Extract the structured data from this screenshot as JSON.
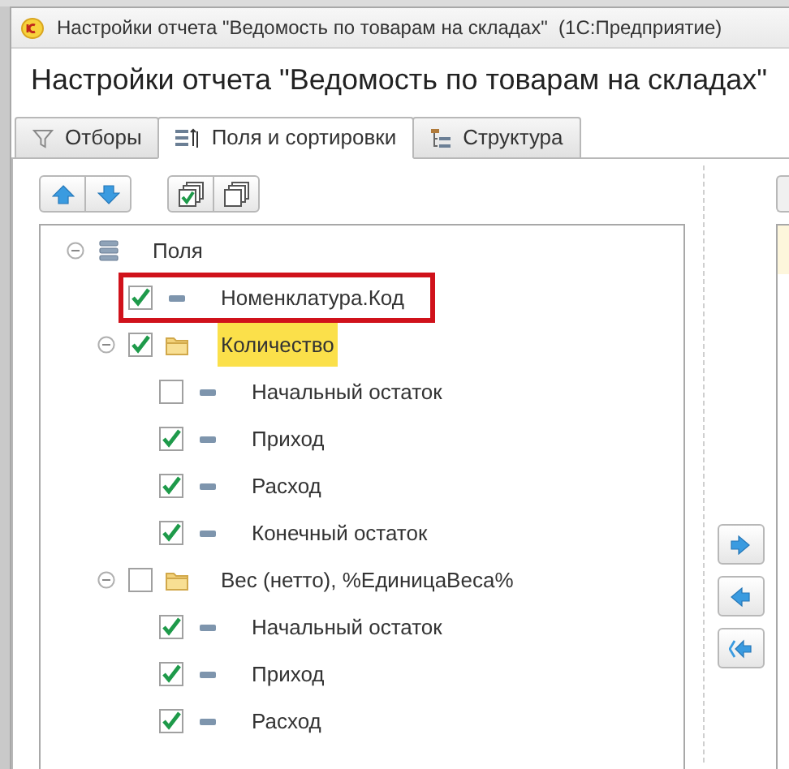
{
  "window": {
    "title": "Настройки отчета \"Ведомость по товарам на складах\"  (1С:Предприятие)"
  },
  "heading": "Настройки отчета \"Ведомость по товарам на складах\"",
  "tabs": [
    {
      "label": "Отборы",
      "kind": "filter",
      "selected": false
    },
    {
      "label": "Поля и сортировки",
      "kind": "fields",
      "selected": true
    },
    {
      "label": "Структура",
      "kind": "structure",
      "selected": false
    }
  ],
  "toolbar": [
    {
      "kind": "up"
    },
    {
      "kind": "down"
    },
    {
      "kind": "check-all"
    },
    {
      "kind": "uncheck-all"
    }
  ],
  "tree": [
    {
      "label": "Поля",
      "kind": "root",
      "expanded": true,
      "outlined": false,
      "selected": false,
      "children": [
        {
          "label": "Номенклатура.Код",
          "kind": "field",
          "checked": true,
          "outlined": true,
          "selected": false
        },
        {
          "label": "Количество",
          "kind": "group",
          "checked": true,
          "expanded": true,
          "outlined": false,
          "selected": true,
          "children": [
            {
              "label": "Начальный остаток",
              "kind": "field",
              "checked": false,
              "outlined": false,
              "selected": false
            },
            {
              "label": "Приход",
              "kind": "field",
              "checked": true,
              "outlined": false,
              "selected": false
            },
            {
              "label": "Расход",
              "kind": "field",
              "checked": true,
              "outlined": false,
              "selected": false
            },
            {
              "label": "Конечный остаток",
              "kind": "field",
              "checked": true,
              "outlined": false,
              "selected": false
            }
          ]
        },
        {
          "label": "Вес (нетто), %ЕдиницаВеса%",
          "kind": "group",
          "checked": false,
          "expanded": true,
          "outlined": false,
          "selected": false,
          "children": [
            {
              "label": "Начальный остаток",
              "kind": "field",
              "checked": true,
              "outlined": false,
              "selected": false
            },
            {
              "label": "Приход",
              "kind": "field",
              "checked": true,
              "outlined": false,
              "selected": false
            },
            {
              "label": "Расход",
              "kind": "field",
              "checked": true,
              "outlined": false,
              "selected": false
            }
          ]
        }
      ]
    }
  ],
  "side_buttons": [
    {
      "kind": "add"
    },
    {
      "kind": "remove"
    },
    {
      "kind": "remove-all"
    }
  ]
}
